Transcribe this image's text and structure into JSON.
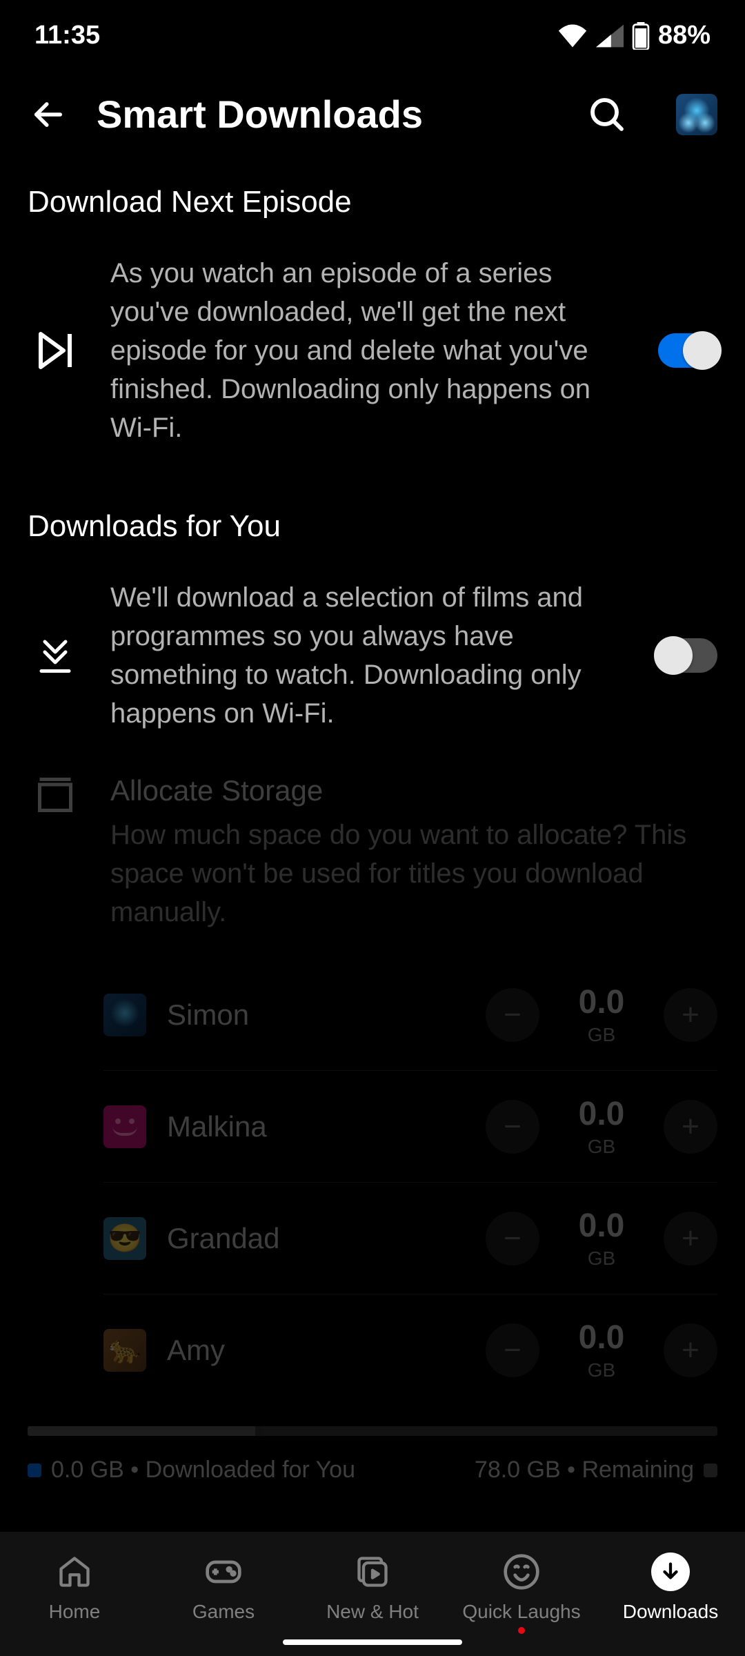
{
  "status": {
    "time": "11:35",
    "battery": "88%"
  },
  "header": {
    "title": "Smart Downloads"
  },
  "section1": {
    "title": "Download Next Episode",
    "desc": "As you watch an episode of a series you've downloaded, we'll get the next episode for you and delete what you've finished. Downloading only happens on Wi-Fi.",
    "toggle": true
  },
  "section2": {
    "title": "Downloads for You",
    "desc": "We'll download a selection of films and programmes so you always have something to watch. Downloading only happens on Wi-Fi.",
    "toggle": false
  },
  "allocate": {
    "title": "Allocate Storage",
    "desc": "How much space do you want to allocate? This space won't be used for titles you download manually."
  },
  "profiles": [
    {
      "name": "Simon",
      "value": "0.0",
      "unit": "GB",
      "avatar": "pa-simon"
    },
    {
      "name": "Malkina",
      "value": "0.0",
      "unit": "GB",
      "avatar": "pa-malkina"
    },
    {
      "name": "Grandad",
      "value": "0.0",
      "unit": "GB",
      "avatar": "pa-grandad"
    },
    {
      "name": "Amy",
      "value": "0.0",
      "unit": "GB",
      "avatar": "pa-amy"
    }
  ],
  "storage": {
    "downloaded": "0.0 GB • Downloaded for You",
    "remaining": "78.0 GB • Remaining"
  },
  "nav": {
    "home": "Home",
    "games": "Games",
    "newhot": "New & Hot",
    "quick": "Quick Laughs",
    "downloads": "Downloads"
  }
}
